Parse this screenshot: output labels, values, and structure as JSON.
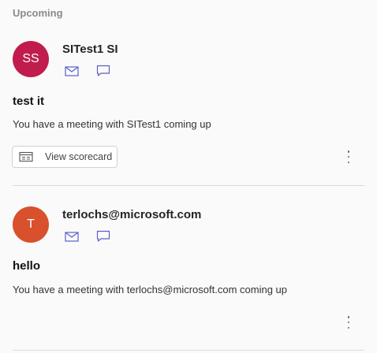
{
  "section": {
    "title": "Upcoming"
  },
  "colors": {
    "accent": "#5b5fc7",
    "avatar1": "#c01c4c",
    "avatar2": "#d9502c"
  },
  "cards": [
    {
      "initials": "SS",
      "name": "SITest1 SI",
      "icons": [
        "mail-icon",
        "chat-icon"
      ],
      "subject": "test it",
      "description": "You have a meeting with SITest1 coming up",
      "action_label": "View scorecard",
      "more_icon": "more-vertical-icon"
    },
    {
      "initials": "T",
      "name": "terlochs@microsoft.com",
      "icons": [
        "mail-icon",
        "chat-icon"
      ],
      "subject": "hello",
      "description": "You have a meeting with terlochs@microsoft.com coming up",
      "more_icon": "more-vertical-icon"
    }
  ]
}
